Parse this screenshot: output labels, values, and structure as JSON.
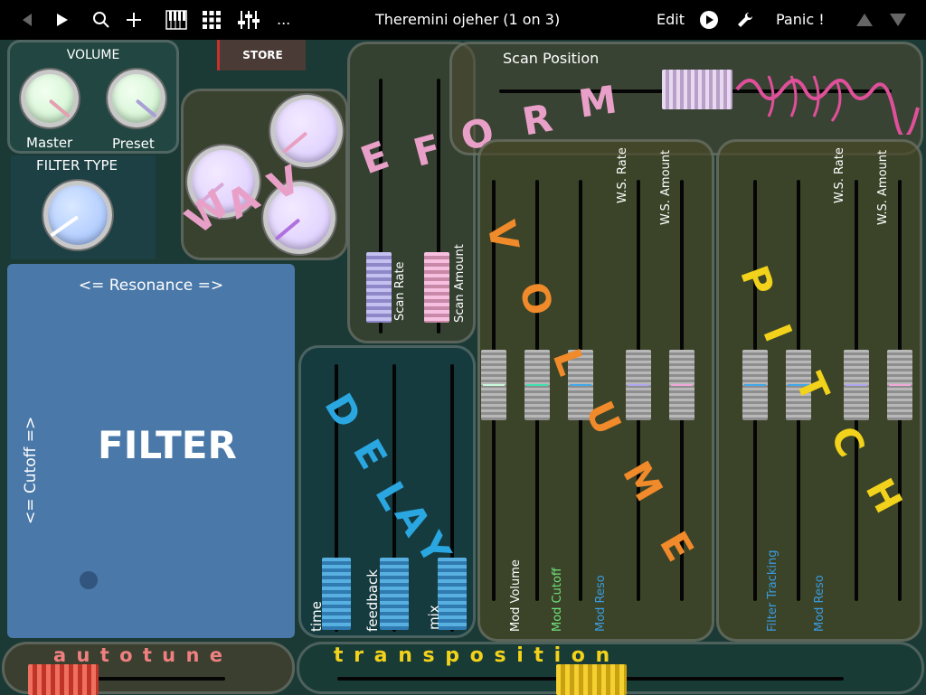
{
  "topbar": {
    "title": "Theremini ojeher  (1 on 3)",
    "edit_label": "Edit",
    "panic_label": "Panic !",
    "more_label": "..."
  },
  "store_label": "STORE",
  "volume": {
    "title": "VOLUME",
    "master_label": "Master",
    "preset_label": "Preset"
  },
  "filter_type": {
    "title": "FILTER TYPE"
  },
  "filter_pad": {
    "label": "FILTER",
    "resonance_label": "<=  Resonance  =>",
    "cutoff_label": "<=  Cutoff  =>"
  },
  "scan": {
    "title": "Scan Position",
    "rate_label": "Scan Rate",
    "amount_label": "Scan Amount"
  },
  "waveform_word": [
    "W",
    "A",
    "V",
    "E",
    "F",
    "O",
    "R",
    "M"
  ],
  "delay": {
    "word": [
      "D",
      "E",
      "L",
      "A",
      "Y"
    ],
    "time_label": "time",
    "feedback_label": "feedback",
    "mix_label": "mix"
  },
  "volume_section": {
    "word": [
      "V",
      "O",
      "L",
      "U",
      "M",
      "E"
    ],
    "mod_volume": "Mod Volume",
    "mod_cutoff": "Mod Cutoff",
    "mod_reso": "Mod Reso",
    "ws_rate": "W.S. Rate",
    "ws_amount": "W.S. Amount"
  },
  "pitch_section": {
    "word": [
      "P",
      "I",
      "T",
      "C",
      "H"
    ],
    "filter_tracking": "Filter Tracking",
    "mod_reso": "Mod Reso",
    "ws_rate": "W.S. Rate",
    "ws_amount": "W.S. Amount"
  },
  "bottom": {
    "autotune_label": "a u t o t u n e",
    "transposition_label": "t r a n s p o s i t i o n"
  },
  "colors": {
    "accent_pink": "#e9a0c8",
    "accent_orange": "#f08a2a",
    "accent_yellow": "#f2d21a",
    "accent_blue": "#2aa6e0",
    "accent_green": "#6fe07a",
    "autotune_red": "#e04a3a"
  }
}
